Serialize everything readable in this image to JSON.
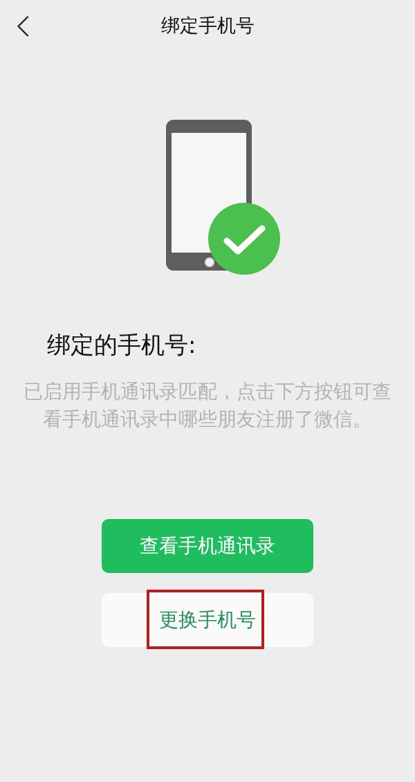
{
  "nav_bar": {
    "title": "绑定手机号"
  },
  "section_title": "绑定的手机号:",
  "description": "已启用手机通讯录匹配，点击下方按钮可查看手机通讯录中哪些朋友注册了微信。",
  "buttons": [
    {
      "label": "查看手机通讯录",
      "kind": "primary",
      "highlighted": false
    },
    {
      "label": "更换手机号",
      "kind": "secondary",
      "highlighted": true
    }
  ]
}
